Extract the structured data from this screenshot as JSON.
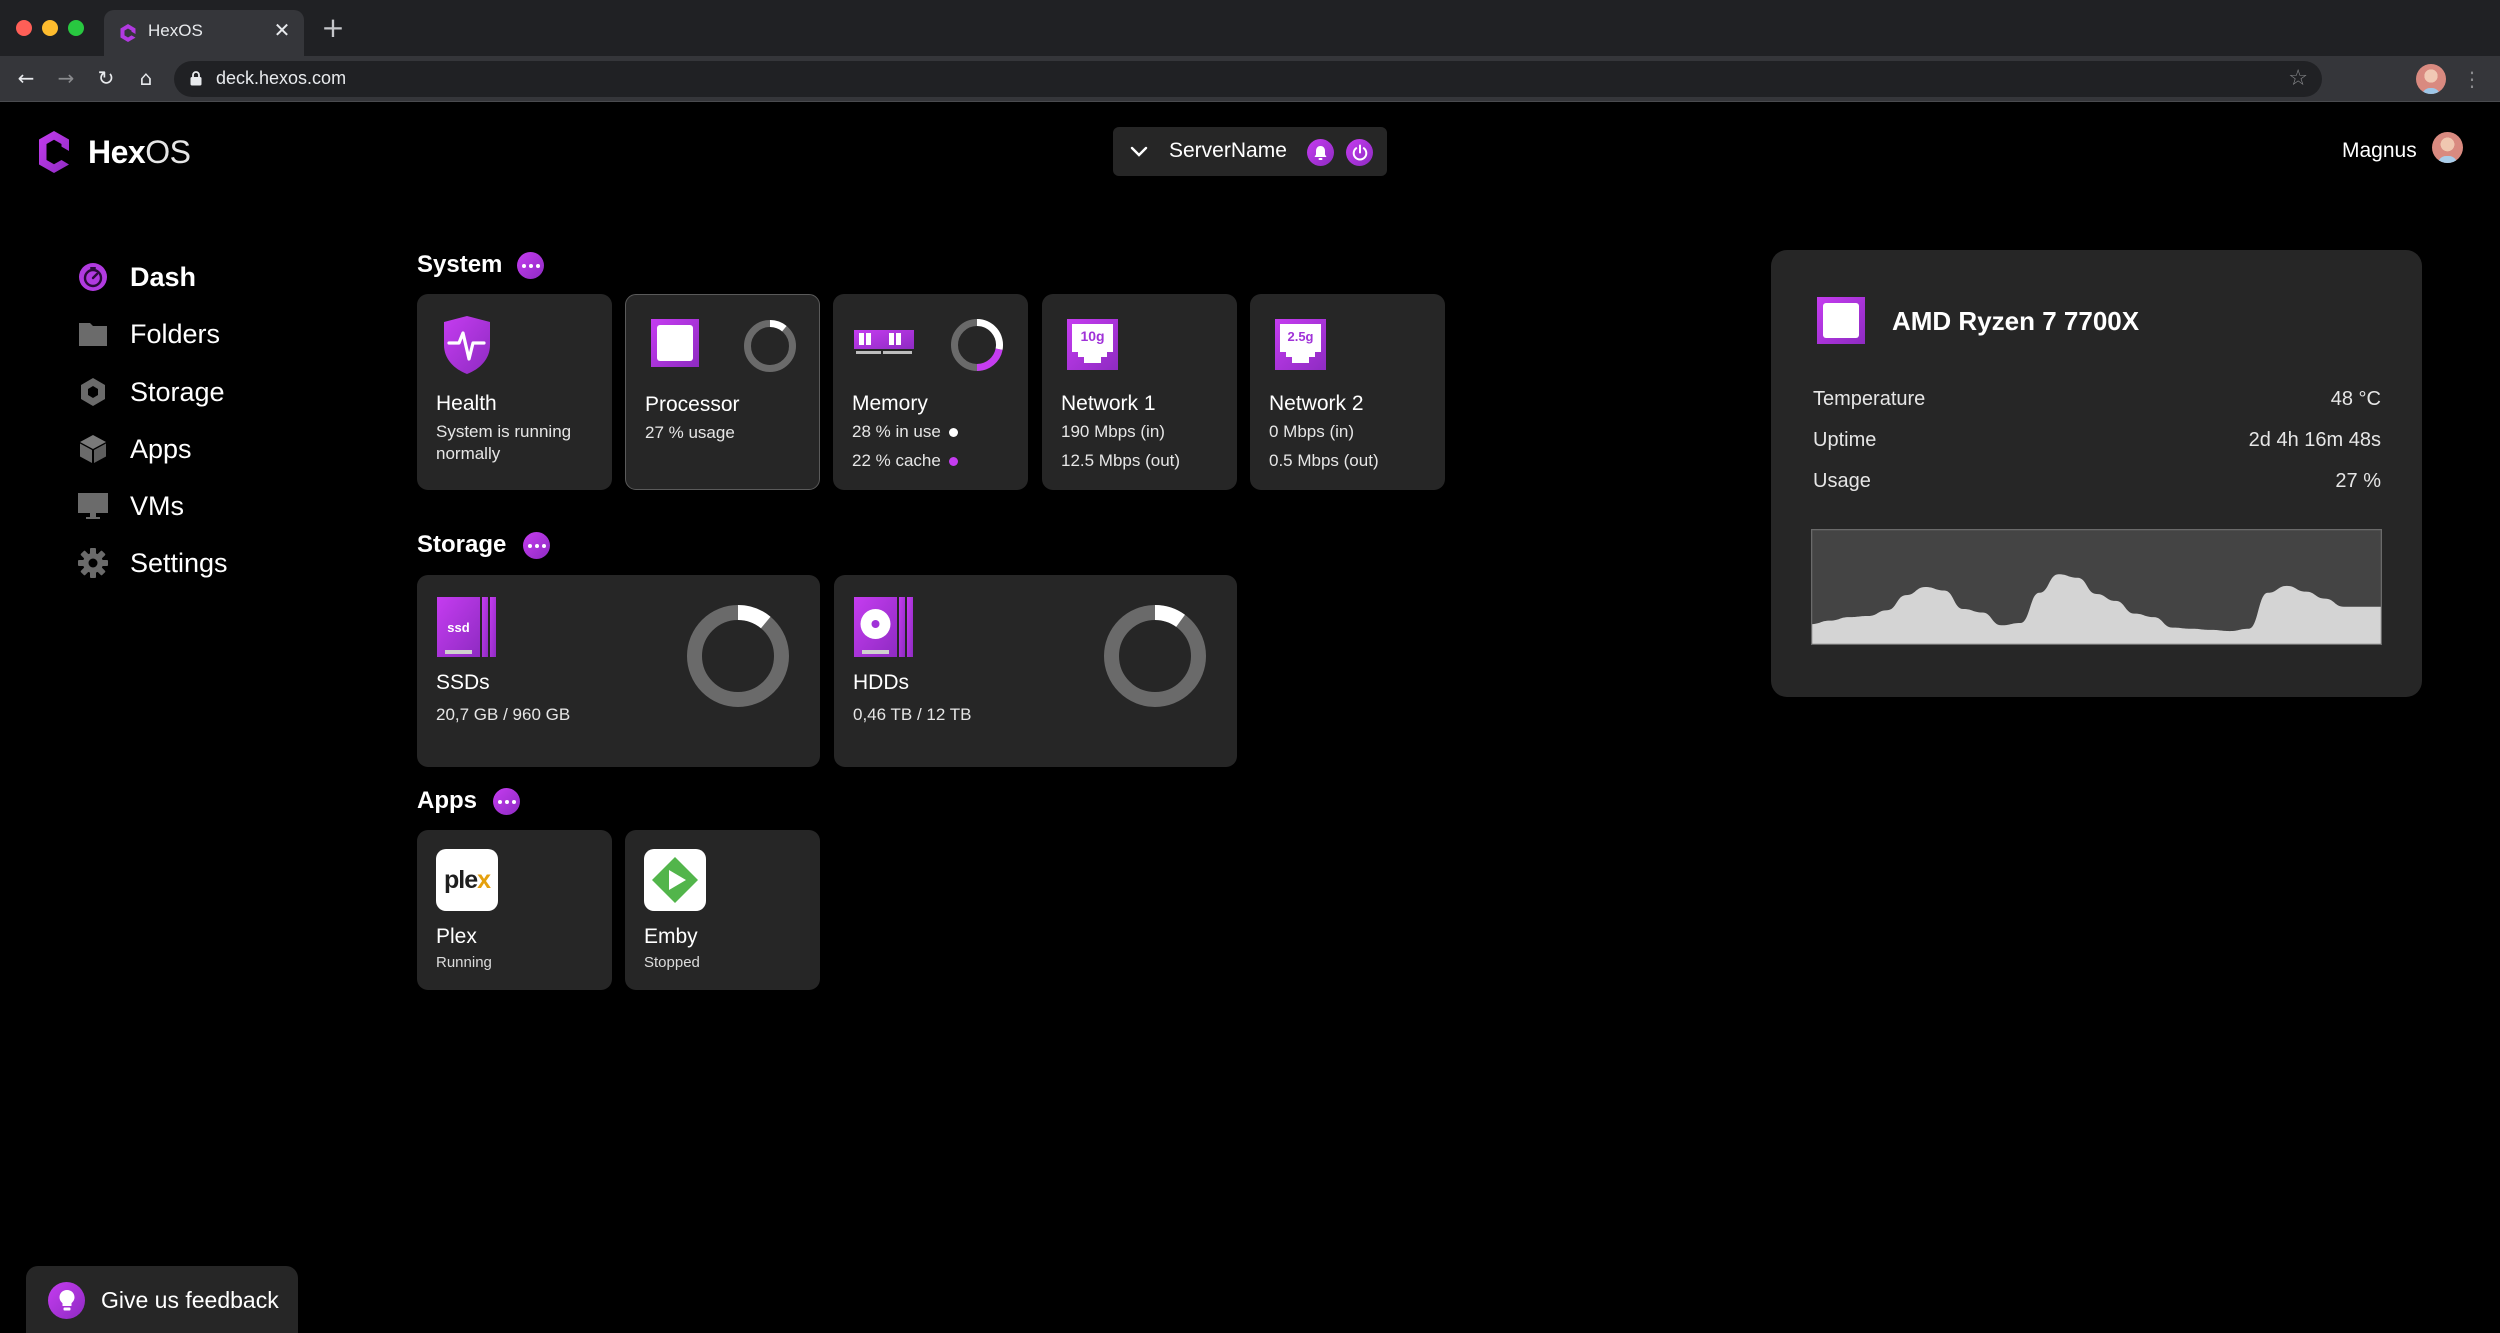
{
  "browser": {
    "tab_title": "HexOS",
    "url": "deck.hexos.com",
    "icons": {
      "back": "arrow-left-icon",
      "forward": "arrow-right-icon",
      "reload": "reload-icon",
      "home": "home-icon",
      "lock": "lock-icon",
      "bookmark": "star-icon",
      "menu": "kebab-menu-icon",
      "close_tab": "close-icon",
      "new_tab": "plus-icon"
    }
  },
  "header": {
    "logo_bold": "Hex",
    "logo_light": "OS",
    "server_name": "ServerName",
    "user_name": "Magnus"
  },
  "theme": {
    "accent": "#b13ae0",
    "accent_light": "#c53cf0",
    "accent_dark": "#8e2bc2",
    "card_bg": "#262626",
    "gauge_track": "#6a6a6a",
    "gauge_fill": "#ffffff"
  },
  "sidebar": {
    "items": [
      {
        "label": "Dash",
        "icon": "gauge-icon",
        "active": true
      },
      {
        "label": "Folders",
        "icon": "folder-icon",
        "active": false
      },
      {
        "label": "Storage",
        "icon": "hexagon-icon",
        "active": false
      },
      {
        "label": "Apps",
        "icon": "cube-icon",
        "active": false
      },
      {
        "label": "VMs",
        "icon": "monitor-icon",
        "active": false
      },
      {
        "label": "Settings",
        "icon": "gear-icon",
        "active": false
      }
    ]
  },
  "system": {
    "title": "System",
    "health": {
      "title": "Health",
      "status_line1": "System is running",
      "status_line2": "normally"
    },
    "processor": {
      "title": "Processor",
      "usage_text": "27 % usage",
      "usage_fraction": 0.11
    },
    "memory": {
      "title": "Memory",
      "in_use_text": "28 % in use",
      "cache_text": "22 % cache",
      "in_use_fraction": 0.28,
      "cache_fraction": 0.22
    },
    "network1": {
      "title": "Network 1",
      "badge": "10g",
      "in": "190 Mbps (in)",
      "out": "12.5 Mbps (out)"
    },
    "network2": {
      "title": "Network 2",
      "badge": "2.5g",
      "in": "0 Mbps (in)",
      "out": "0.5 Mbps (out)"
    }
  },
  "storage": {
    "title": "Storage",
    "ssd": {
      "title": "SSDs",
      "badge": "ssd",
      "usage": "20,7 GB / 960 GB",
      "fraction": 0.11
    },
    "hdd": {
      "title": "HDDs",
      "usage": "0,46 TB / 12 TB",
      "fraction": 0.1
    }
  },
  "apps": {
    "title": "Apps",
    "items": [
      {
        "name": "Plex",
        "status": "Running",
        "logo_text": "ple",
        "logo_x": "x"
      },
      {
        "name": "Emby",
        "status": "Stopped"
      }
    ]
  },
  "cpu_panel": {
    "name": "AMD Ryzen 7 7700X",
    "stats": [
      {
        "label": "Temperature",
        "value": "48 °C"
      },
      {
        "label": "Uptime",
        "value": "2d 4h 16m 48s"
      },
      {
        "label": "Usage",
        "value": "27 %"
      }
    ],
    "usage_history": [
      0.18,
      0.21,
      0.24,
      0.25,
      0.3,
      0.43,
      0.5,
      0.47,
      0.31,
      0.28,
      0.17,
      0.19,
      0.45,
      0.61,
      0.58,
      0.44,
      0.38,
      0.27,
      0.24,
      0.15,
      0.14,
      0.13,
      0.12,
      0.14,
      0.45,
      0.51,
      0.46,
      0.4,
      0.33,
      0.33,
      0.33
    ]
  },
  "feedback": {
    "label": "Give us feedback"
  }
}
